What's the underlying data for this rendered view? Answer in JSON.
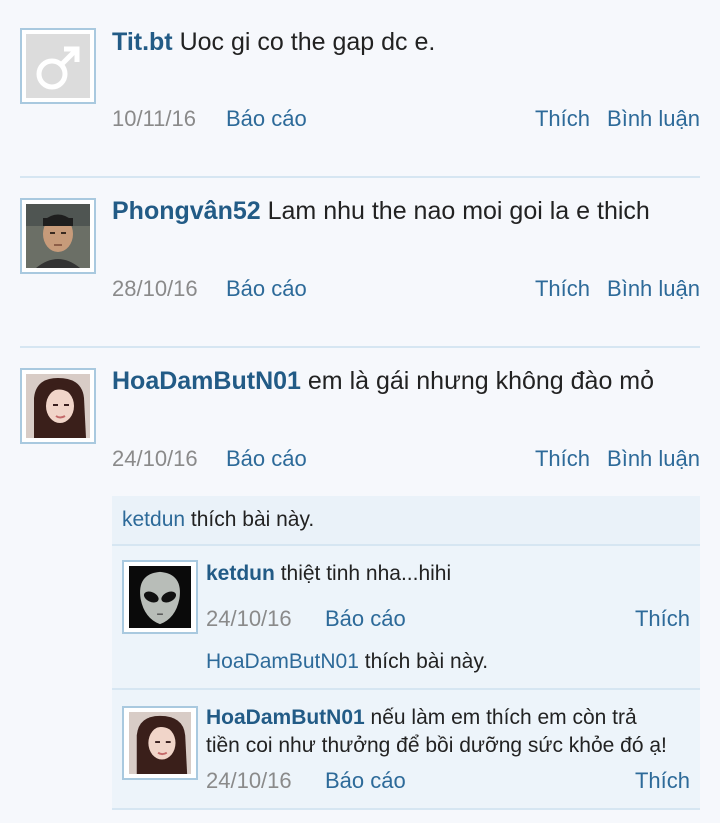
{
  "posts": [
    {
      "username": "Tit.bt",
      "message": "Uoc gi co the gap dc e.",
      "date": "10/11/16",
      "report_label": "Báo cáo",
      "like_label": "Thích",
      "comment_label": "Bình luận",
      "avatar": "male-symbol-icon"
    },
    {
      "username": "Phongvân52",
      "message": "Lam nhu the nao moi goi la e thich",
      "date": "28/10/16",
      "report_label": "Báo cáo",
      "like_label": "Thích",
      "comment_label": "Bình luận",
      "avatar": "user-photo-man"
    },
    {
      "username": "HoaDamButN01",
      "message": "em là gái nhưng không đào mỏ",
      "date": "24/10/16",
      "report_label": "Báo cáo",
      "like_label": "Thích",
      "comment_label": "Bình luận",
      "avatar": "user-photo-woman",
      "liked_by": "ketdun",
      "liked_text": "thích bài này.",
      "replies": [
        {
          "username": "ketdun",
          "message": "thiệt tinh nha...hihi",
          "date": "24/10/16",
          "report_label": "Báo cáo",
          "like_label": "Thích",
          "liked_by": "HoaDamButN01",
          "liked_text": "thích bài này.",
          "avatar": "alien-photo"
        },
        {
          "username": "HoaDamButN01",
          "message_line1": "nếu làm em thích em còn trả",
          "message_line2": "tiền coi như thưởng để bồi dưỡng sức khỏe đó ạ!",
          "date": "24/10/16",
          "report_label": "Báo cáo",
          "like_label": "Thích",
          "avatar": "user-photo-woman"
        }
      ]
    }
  ],
  "colors": {
    "username": "#225b86",
    "link": "#2d6a99",
    "date": "#8a8a8a",
    "background": "#f6f8fc"
  }
}
